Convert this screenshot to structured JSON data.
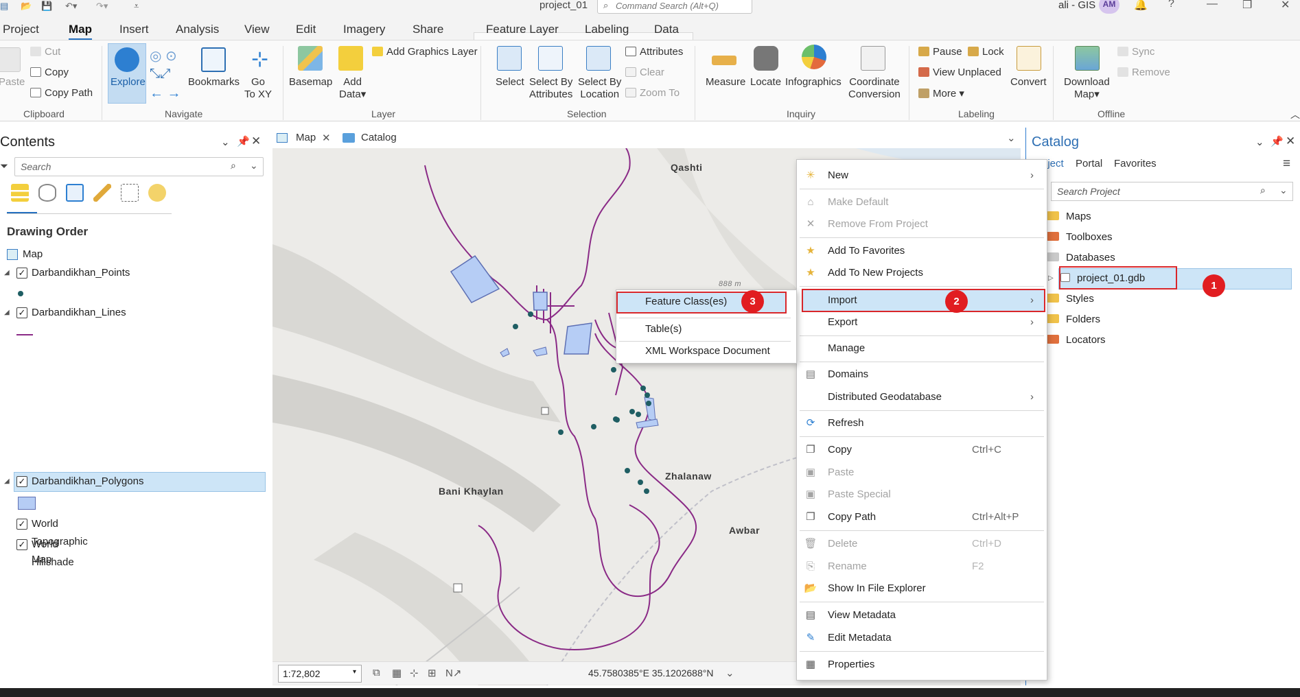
{
  "app": {
    "project_title": "project_01",
    "command_search_placeholder": "Command Search (Alt+Q)",
    "user": "ali - GIS",
    "avatar": "AM"
  },
  "ribbon_tabs": [
    "Project",
    "Map",
    "Insert",
    "Analysis",
    "View",
    "Edit",
    "Imagery",
    "Share",
    "Feature Layer",
    "Labeling",
    "Data"
  ],
  "active_tab": "Map",
  "ribbon": {
    "clipboard": {
      "group": "Clipboard",
      "paste": "Paste",
      "cut": "Cut",
      "copy": "Copy",
      "copy_path": "Copy Path"
    },
    "navigate": {
      "group": "Navigate",
      "explore": "Explore",
      "bookmarks": "Bookmarks",
      "go_to_xy_1": "Go",
      "go_to_xy_2": "To XY"
    },
    "layer": {
      "group": "Layer",
      "basemap": "Basemap",
      "add_data_1": "Add",
      "add_data_2": "Data",
      "add_graphics_layer": "Add Graphics Layer"
    },
    "selection": {
      "group": "Selection",
      "select": "Select",
      "select_by_attr_1": "Select By",
      "select_by_attr_2": "Attributes",
      "select_by_loc_1": "Select By",
      "select_by_loc_2": "Location",
      "attributes": "Attributes",
      "clear": "Clear",
      "zoom_to": "Zoom To"
    },
    "inquiry": {
      "group": "Inquiry",
      "measure": "Measure",
      "locate": "Locate",
      "infographics": "Infographics",
      "coord_conv_1": "Coordinate",
      "coord_conv_2": "Conversion"
    },
    "labeling": {
      "group": "Labeling",
      "pause": "Pause",
      "lock": "Lock",
      "view_unplaced": "View Unplaced",
      "more": "More",
      "convert": "Convert"
    },
    "offline": {
      "group": "Offline",
      "download_map_1": "Download",
      "download_map_2": "Map",
      "sync": "Sync",
      "remove": "Remove"
    }
  },
  "contents": {
    "title": "Contents",
    "search_placeholder": "Search",
    "drawing_order": "Drawing Order",
    "map_label": "Map",
    "layers": [
      "Darbandikhan_Points",
      "Darbandikhan_Lines",
      "Darbandikhan_Polygons",
      "World Topographic Map",
      "World Hillshade"
    ]
  },
  "map_view": {
    "tabs": [
      "Map",
      "Catalog"
    ],
    "places": [
      "Qashti",
      "Bani Khaylan",
      "Zhalanaw",
      "Awbar"
    ],
    "elevation_label": "888 m",
    "scale": "1:72,802",
    "coordinates": "45.7580385°E 35.1202688°N"
  },
  "catalog": {
    "title": "Catalog",
    "tabs": [
      "Project",
      "Portal",
      "Favorites"
    ],
    "search_placeholder": "Search Project",
    "items": [
      "Maps",
      "Toolboxes",
      "Databases",
      "project_01.gdb",
      "Styles",
      "Folders",
      "Locators"
    ]
  },
  "context_menu": {
    "new": "New",
    "make_default": "Make Default",
    "remove_from_project": "Remove From Project",
    "add_to_favorites": "Add To Favorites",
    "add_to_new_projects": "Add To New Projects",
    "import": "Import",
    "export": "Export",
    "manage": "Manage",
    "domains": "Domains",
    "distributed_gdb": "Distributed Geodatabase",
    "refresh": "Refresh",
    "copy": "Copy",
    "copy_sc": "Ctrl+C",
    "paste": "Paste",
    "paste_special": "Paste Special",
    "copy_path": "Copy Path",
    "copy_path_sc": "Ctrl+Alt+P",
    "delete": "Delete",
    "delete_sc": "Ctrl+D",
    "rename": "Rename",
    "rename_sc": "F2",
    "show_in_explorer": "Show In File Explorer",
    "view_metadata": "View Metadata",
    "edit_metadata": "Edit Metadata",
    "properties": "Properties"
  },
  "submenu": {
    "feature_classes": "Feature Class(es)",
    "tables": "Table(s)",
    "xml_workspace": "XML Workspace Document"
  },
  "badges": [
    "1",
    "2",
    "3"
  ],
  "colors": {
    "accent": "#2470c0",
    "highlight": "#cde5f7",
    "callout_red": "#d9262a",
    "polygon_fill": "#b6cdf5",
    "line_purple": "#8a2a86",
    "point_teal": "#1f5e63"
  }
}
